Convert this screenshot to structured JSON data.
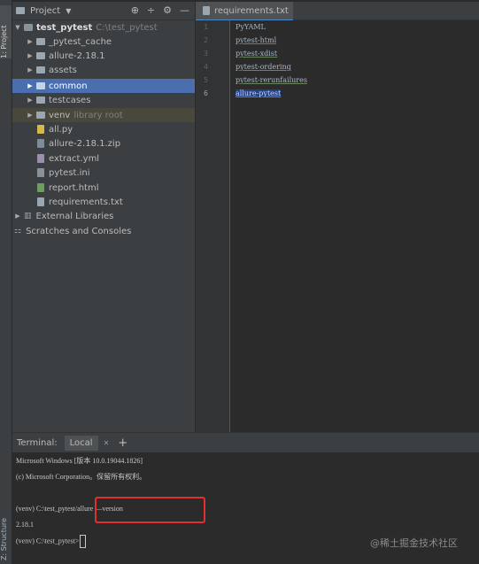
{
  "sidebar_tabs": {
    "project": "1: Project",
    "structure": "Z: Structure"
  },
  "project_panel": {
    "title": "Project",
    "toolbar_icons": [
      "target-icon",
      "split-icon",
      "gear-icon",
      "minimize-icon"
    ],
    "root": {
      "name": "test_pytest",
      "path": "C:\\test_pytest"
    },
    "items": [
      {
        "label": "_pytest_cache",
        "kind": "folder"
      },
      {
        "label": "allure-2.18.1",
        "kind": "folder"
      },
      {
        "label": "assets",
        "kind": "folder"
      },
      {
        "label": "common",
        "kind": "folder",
        "selected": true
      },
      {
        "label": "testcases",
        "kind": "folder"
      },
      {
        "label": "venv",
        "hint": "library root",
        "kind": "folder"
      },
      {
        "label": "all.py",
        "kind": "python"
      },
      {
        "label": "allure-2.18.1.zip",
        "kind": "zip"
      },
      {
        "label": "extract.yml",
        "kind": "yaml"
      },
      {
        "label": "pytest.ini",
        "kind": "ini"
      },
      {
        "label": "report.html",
        "kind": "html"
      },
      {
        "label": "requirements.txt",
        "kind": "text"
      }
    ],
    "external_libraries": "External Libraries",
    "scratches": "Scratches and Consoles"
  },
  "editor": {
    "tab": "requirements.txt",
    "lines": [
      "PyYAML",
      "pytest-html",
      "pytest-xdist",
      "pytest-ordering",
      "pytest-rerunfailures",
      "allure-pytest"
    ],
    "line_numbers": [
      "1",
      "2",
      "3",
      "4",
      "5",
      "6"
    ]
  },
  "terminal": {
    "tab_label": "Terminal:",
    "session": "Local",
    "lines": [
      "Microsoft Windows [版本 10.0.19044.1826]",
      "(c) Microsoft Corporation。保留所有权利。",
      "",
      "(venv) C:\\test_pytest/allure —version",
      "2.18.1",
      "(venv) C:\\test_pytest>"
    ]
  },
  "watermark": "@稀土掘金技术社区",
  "colors": {
    "panel_bg": "#3c3f41",
    "editor_bg": "#2b2b2b",
    "selection": "#4b6eaf",
    "highlight_box": "#e03030"
  }
}
